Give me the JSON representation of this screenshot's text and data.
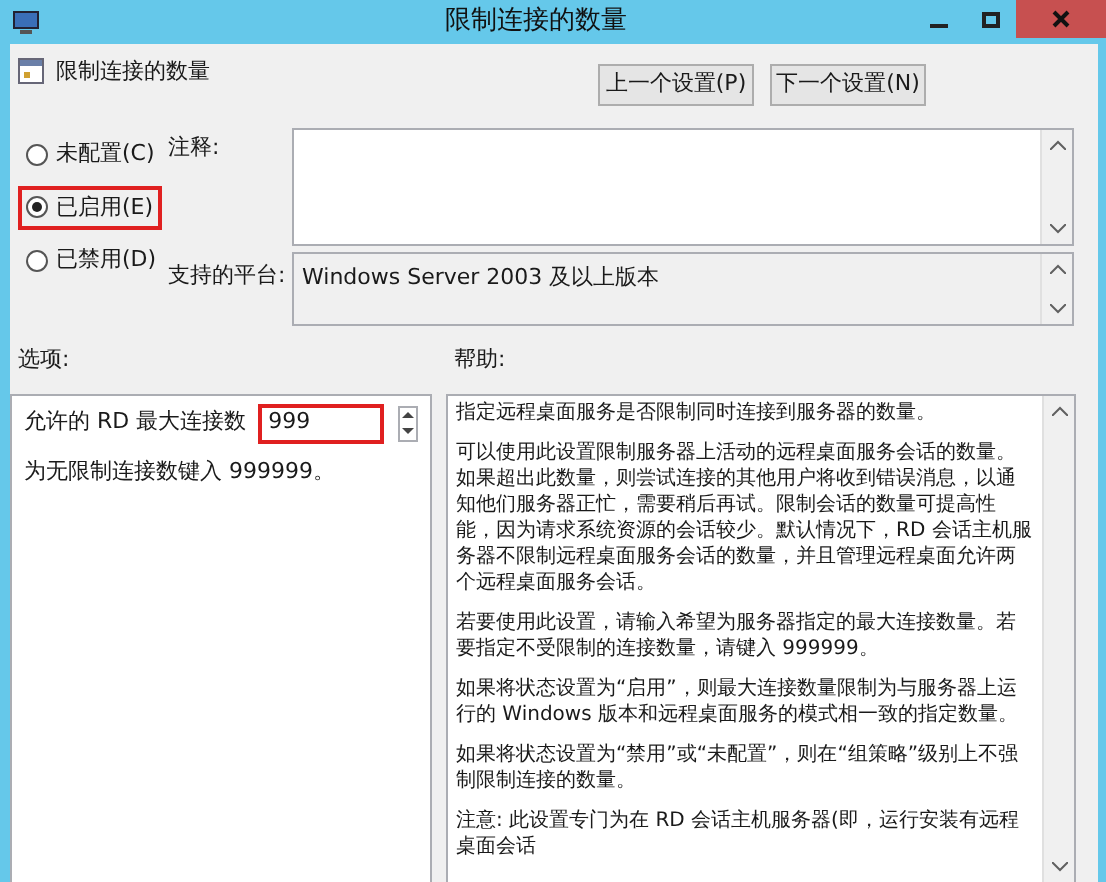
{
  "window": {
    "title": "限制连接的数量"
  },
  "setting": {
    "title": "限制连接的数量"
  },
  "nav_buttons": [
    "上一个设置(P)",
    "下一个设置(N)"
  ],
  "states": [
    {
      "label": "未配置(C)",
      "selected": false,
      "highlighted": false
    },
    {
      "label": "已启用(E)",
      "selected": true,
      "highlighted": true
    },
    {
      "label": "已禁用(D)",
      "selected": false,
      "highlighted": false
    }
  ],
  "comment": {
    "label": "注释:"
  },
  "platform": {
    "label": "支持的平台:",
    "value": "Windows Server 2003 及以上版本"
  },
  "options": {
    "label": "选项:",
    "field_label": "允许的 RD 最大连接数",
    "value": "999",
    "highlighted": true,
    "hint": "为无限制连接数键入 999999。"
  },
  "help": {
    "label": "帮助:",
    "paragraphs": [
      "指定远程桌面服务是否限制同时连接到服务器的数量。",
      "可以使用此设置限制服务器上活动的远程桌面服务会话的数量。如果超出此数量，则尝试连接的其他用户将收到错误消息，以通知他们服务器正忙，需要稍后再试。限制会话的数量可提高性能，因为请求系统资源的会话较少。默认情况下，RD 会话主机服务器不限制远程桌面服务会话的数量，并且管理远程桌面允许两个远程桌面服务会话。",
      "若要使用此设置，请输入希望为服务器指定的最大连接数量。若要指定不受限制的连接数量，请键入 999999。",
      "如果将状态设置为“启用”，则最大连接数量限制为与服务器上运行的 Windows 版本和远程桌面服务的模式相一致的指定数量。",
      "如果将状态设置为“禁用”或“未配置”，则在“组策略”级别上不强制限制连接的数量。",
      "注意: 此设置专门为在 RD 会话主机服务器(即，运行安装有远程桌面会话"
    ]
  }
}
